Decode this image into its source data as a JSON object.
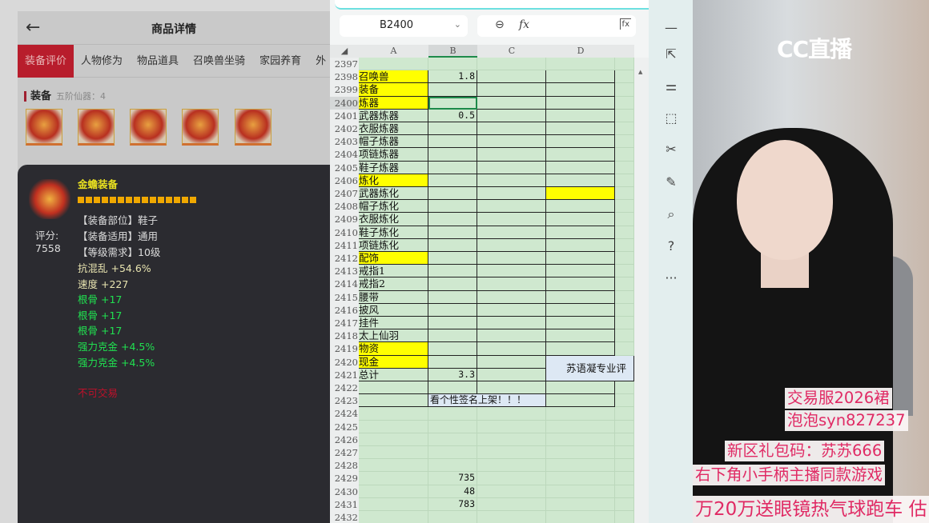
{
  "left": {
    "title": "商品详情",
    "tabs": [
      "装备评价",
      "人物修为",
      "物品道具",
      "召唤兽坐骑",
      "家园养育",
      "外"
    ],
    "section": {
      "label": "装备",
      "sub": "五阶仙器：4"
    },
    "item": {
      "name": "金蟾装备",
      "score_label": "评分:",
      "score": "7558",
      "attrs": [
        "【装备部位】鞋子",
        "【装备适用】通用",
        "【等级需求】10级"
      ],
      "stats": [
        {
          "t": "抗混乱 +54.6%",
          "c": "cre"
        },
        {
          "t": "速度 +227",
          "c": "cre"
        },
        {
          "t": "根骨 +17",
          "c": "grn"
        },
        {
          "t": "根骨 +17",
          "c": "grn"
        },
        {
          "t": "根骨 +17",
          "c": "grn"
        },
        {
          "t": "强力克金 +4.5%",
          "c": "grn"
        },
        {
          "t": "强力克金 +4.5%",
          "c": "grn"
        }
      ],
      "note": "不可交易",
      "stars": 15
    }
  },
  "sheet": {
    "namebox": "B2400",
    "columns": [
      "A",
      "B",
      "C",
      "D"
    ],
    "rows": [
      {
        "n": "2397"
      },
      {
        "n": "2398",
        "a": "召唤兽",
        "ay": true,
        "b": "1.8"
      },
      {
        "n": "2399",
        "a": "装备",
        "ay": true
      },
      {
        "n": "2400",
        "a": "炼器",
        "ay": true,
        "sel": true
      },
      {
        "n": "2401",
        "a": "武器炼器",
        "b": "0.5"
      },
      {
        "n": "2402",
        "a": "衣服炼器"
      },
      {
        "n": "2403",
        "a": "帽子炼器"
      },
      {
        "n": "2404",
        "a": "项链炼器"
      },
      {
        "n": "2405",
        "a": "鞋子炼器"
      },
      {
        "n": "2406",
        "a": "炼化",
        "ay": true
      },
      {
        "n": "2407",
        "a": "武器炼化",
        "dy": true
      },
      {
        "n": "2408",
        "a": "帽子炼化"
      },
      {
        "n": "2409",
        "a": "衣服炼化"
      },
      {
        "n": "2410",
        "a": "鞋子炼化"
      },
      {
        "n": "2411",
        "a": "项链炼化"
      },
      {
        "n": "2412",
        "a": "配饰",
        "ay": true
      },
      {
        "n": "2413",
        "a": "戒指1"
      },
      {
        "n": "2414",
        "a": "戒指2"
      },
      {
        "n": "2415",
        "a": "腰带"
      },
      {
        "n": "2416",
        "a": "披风"
      },
      {
        "n": "2417",
        "a": "挂件"
      },
      {
        "n": "2418",
        "a": "太上仙羽"
      },
      {
        "n": "2419",
        "a": "物资",
        "ay": true
      },
      {
        "n": "2420",
        "a": "现金",
        "ay": true
      },
      {
        "n": "2421",
        "a": "总计",
        "b": "3.3"
      },
      {
        "n": "2422"
      },
      {
        "n": "2423"
      },
      {
        "n": "2424"
      },
      {
        "n": "2425"
      },
      {
        "n": "2426"
      },
      {
        "n": "2427"
      },
      {
        "n": "2428"
      },
      {
        "n": "2429",
        "b": "735"
      },
      {
        "n": "2430",
        "b": "48"
      },
      {
        "n": "2431",
        "b": "783"
      },
      {
        "n": "2432"
      }
    ],
    "merged_d": "苏语凝专业评",
    "merged_bc": "看个性签名上架！！！"
  },
  "stream": {
    "logo": "CC直播",
    "overlays": [
      "交易服2026裙",
      "泡泡syn827237",
      "新区礼包码：苏苏666",
      "右下角小手柄主播同款游戏",
      "万20万送眼镜热气球跑车  估"
    ]
  }
}
